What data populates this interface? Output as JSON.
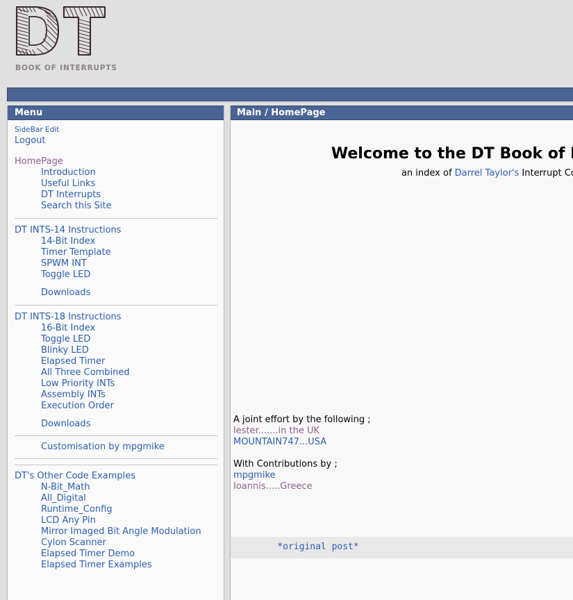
{
  "site": {
    "logo_text": "DT",
    "logo_icon": "dt-sketch-logo",
    "tagline": "BOOK OF INTERRUPTS"
  },
  "colors": {
    "header_blue": "#4a6595",
    "link_blue": "#2b5eb0",
    "link_visited": "#8d5e8d",
    "page_bg": "#e0e0e0",
    "panel_bg": "#fafafa",
    "main_bg": "#f8f8f8",
    "code_bg": "#e8e8e8",
    "tagline_gray": "#8a8289"
  },
  "sidebar": {
    "title": "Menu",
    "account": [
      {
        "label": "SideBar Edit",
        "style": "small"
      },
      {
        "label": "Logout",
        "style": "normal"
      }
    ],
    "groups": [
      {
        "heading": "HomePage",
        "heading_visited": true,
        "items": [
          "Introduction",
          "Useful Links",
          "DT Interrupts",
          "Search this Site"
        ],
        "downloads": null
      },
      {
        "heading": "DT INTS-14 Instructions",
        "heading_visited": false,
        "items": [
          "14-Bit Index",
          "Timer Template",
          "SPWM INT",
          "Toggle LED"
        ],
        "downloads": "Downloads"
      },
      {
        "heading": "DT INTS-18 Instructions",
        "heading_visited": false,
        "items": [
          "16-Bit Index",
          "Toggle LED",
          "Blinky LED",
          "Elapsed Timer",
          "All Three Combined",
          "Low Priority INTs",
          "Assembly INTs",
          "Execution Order"
        ],
        "downloads": "Downloads"
      }
    ],
    "customisation": "Customisation by mpgmike",
    "other_examples": {
      "heading": "DT's Other Code Examples",
      "items": [
        "N-Bit_Math",
        "All_Digital",
        "Runtime_Config",
        "LCD Any Pin",
        "Mirror Imaged Bit Angle Modulation",
        "Cylon Scanner",
        "Elapsed Timer Demo",
        "Elapsed Timer Examples"
      ]
    }
  },
  "main": {
    "breadcrumb": "Main / HomePage",
    "welcome_heading": "Welcome to the DT Book of Interrupts",
    "subtitle_prefix": "an index of ",
    "subtitle_link": "Darrel Taylor's",
    "subtitle_suffix": " Interrupt Code",
    "credits": {
      "joint_effort_label": "A joint effort by the following ;",
      "joint_effort": [
        {
          "name": "lester.......in the UK",
          "color": "visited"
        },
        {
          "name": "MOUNTAIN747...USA",
          "color": "link"
        }
      ],
      "contributions_label": "With Contributions by ;",
      "contributions": [
        {
          "name": "mpgmike",
          "color": "link"
        },
        {
          "name": "Ioannis.....Greece",
          "color": "visited"
        }
      ]
    },
    "code": "    *original post*"
  }
}
